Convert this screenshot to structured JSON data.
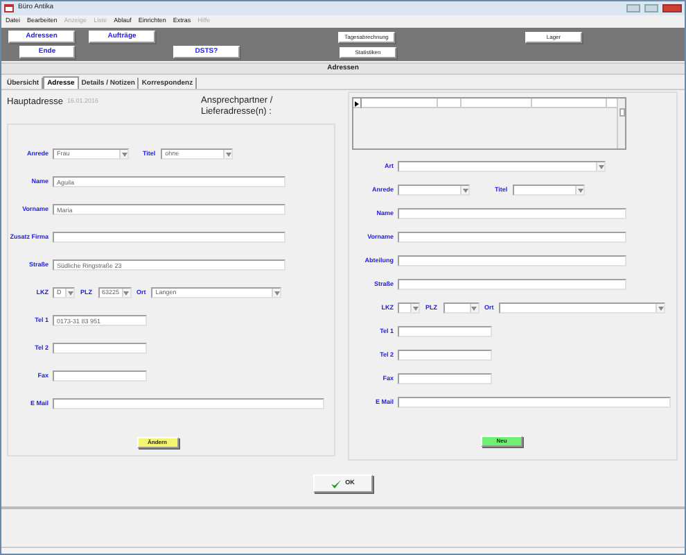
{
  "window": {
    "title": "Büro Antika"
  },
  "menu": [
    {
      "label": "Datei",
      "disabled": false
    },
    {
      "label": "Bearbeiten",
      "disabled": false
    },
    {
      "label": "Anzeige",
      "disabled": true
    },
    {
      "label": "Liste",
      "disabled": true
    },
    {
      "label": "Ablauf",
      "disabled": false
    },
    {
      "label": "Einrichten",
      "disabled": false
    },
    {
      "label": "Extras",
      "disabled": false
    },
    {
      "label": "Hilfe",
      "disabled": true
    }
  ],
  "toolbar": {
    "row_1": [
      {
        "label": "Adressen",
        "kind": "main"
      },
      {
        "label": "Aufträge",
        "kind": "main"
      },
      {
        "label": "Tagesabrechnung",
        "kind": "plain"
      },
      {
        "label": "Lager",
        "kind": "plain"
      }
    ],
    "row_2": [
      {
        "label": "Ende",
        "kind": "main"
      },
      {
        "label": "DSTS?",
        "kind": "main"
      },
      {
        "label": "Statistiken",
        "kind": "plain"
      }
    ]
  },
  "page_header": "Adressen",
  "tabs": [
    {
      "label": "Übersicht",
      "selected": false
    },
    {
      "label": "Adresse",
      "selected": true
    },
    {
      "label": "Details / Notizen",
      "selected": false
    },
    {
      "label": "Korrespondenz",
      "selected": false
    }
  ],
  "main_address": {
    "title": "Hauptadresse",
    "date": "16.01.2016",
    "form_lines": [
      {
        "fields": [
          {
            "label": "Anrede",
            "kind": "select",
            "value": "Frau"
          },
          {
            "label": "Titel",
            "kind": "select",
            "value": "ohne"
          }
        ]
      },
      {
        "fields": [
          {
            "label": "Name",
            "kind": "text",
            "value": "Aguila"
          }
        ]
      },
      {
        "fields": [
          {
            "label": "Vorname",
            "kind": "text",
            "value": "Maria"
          }
        ]
      },
      {
        "fields": [
          {
            "label": "Zusatz Firma",
            "kind": "text"
          }
        ]
      },
      {
        "fields": [
          {
            "label": "Straße",
            "kind": "text",
            "value": "Südliche Ringstraße 23"
          }
        ]
      },
      {
        "fields": [
          {
            "label": "LKZ",
            "kind": "select",
            "value": "D"
          },
          {
            "label": "PLZ",
            "kind": "select",
            "value": "63225"
          },
          {
            "label": "Ort",
            "kind": "select",
            "value": "Langen"
          }
        ]
      },
      {
        "fields": [
          {
            "label": "Tel 1",
            "kind": "short",
            "value": "0173-31 83 951"
          }
        ]
      },
      {
        "fields": [
          {
            "label": "Tel 2",
            "kind": "short"
          }
        ]
      },
      {
        "fields": [
          {
            "label": "Fax",
            "kind": "short"
          }
        ]
      },
      {
        "fields": [
          {
            "label": "E Mail",
            "kind": "wide"
          }
        ]
      }
    ],
    "button": "Ändern"
  },
  "contacts": {
    "title": "Ansprechpartner / Lieferadresse(n) :",
    "form_lines": [
      {
        "fields": [
          {
            "label": "Art",
            "kind": "select"
          }
        ]
      },
      {
        "fields": [
          {
            "label": "Anrede",
            "kind": "select"
          },
          {
            "label": "Titel",
            "kind": "select"
          }
        ]
      },
      {
        "fields": [
          {
            "label": "Name",
            "kind": "text"
          }
        ]
      },
      {
        "fields": [
          {
            "label": "Vorname",
            "kind": "text"
          }
        ]
      },
      {
        "fields": [
          {
            "label": "Abteilung",
            "kind": "text"
          }
        ]
      },
      {
        "fields": [
          {
            "label": "Straße",
            "kind": "text"
          }
        ]
      },
      {
        "fields": [
          {
            "label": "LKZ",
            "kind": "select"
          },
          {
            "label": "PLZ",
            "kind": "select"
          },
          {
            "label": "Ort",
            "kind": "select"
          }
        ]
      },
      {
        "fields": [
          {
            "label": "Tel 1",
            "kind": "short"
          }
        ]
      },
      {
        "fields": [
          {
            "label": "Tel 2",
            "kind": "short"
          }
        ]
      },
      {
        "fields": [
          {
            "label": "Fax",
            "kind": "short"
          }
        ]
      },
      {
        "fields": [
          {
            "label": "E Mail",
            "kind": "wide"
          }
        ]
      }
    ],
    "button": "Neu"
  },
  "ok_button": "OK"
}
